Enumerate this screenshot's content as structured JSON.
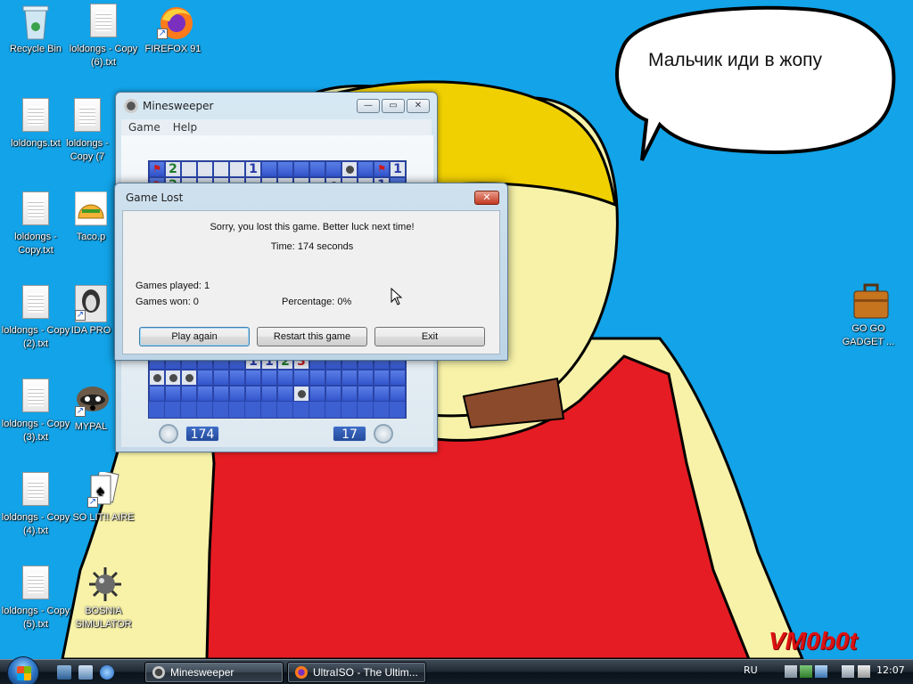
{
  "desktop": {
    "icons": [
      {
        "label": "Recycle Bin",
        "icon": "recycle-bin-icon"
      },
      {
        "label": "loldongs - Copy (6).txt",
        "icon": "text-file-icon"
      },
      {
        "label": "FIREFOX 91",
        "icon": "firefox-icon"
      },
      {
        "label": "loldongs.txt",
        "icon": "text-file-icon"
      },
      {
        "label": "loldongs - Copy (7",
        "icon": "text-file-icon"
      },
      {
        "label": "loldongs - Copy.txt",
        "icon": "text-file-icon"
      },
      {
        "label": "Taco.p",
        "icon": "taco-icon"
      },
      {
        "label": "loldongs - Copy (2).txt",
        "icon": "text-file-icon"
      },
      {
        "label": "IDA PRO",
        "icon": "ida-pro-icon"
      },
      {
        "label": "loldongs - Copy (3).txt",
        "icon": "text-file-icon"
      },
      {
        "label": "MYPAL",
        "icon": "raccoon-icon"
      },
      {
        "label": "loldongs - Copy (4).txt",
        "icon": "text-file-icon"
      },
      {
        "label": "SO LIT!! AIRE",
        "icon": "solitaire-icon"
      },
      {
        "label": "loldongs - Copy (5).txt",
        "icon": "text-file-icon"
      },
      {
        "label": "BOSNIA SIMULATOR",
        "icon": "mine-icon"
      },
      {
        "label": "GO GO GADGET ...",
        "icon": "briefcase-icon"
      }
    ],
    "speech_bubble": "Мальчик иди в жопу",
    "signature": "VM0b0t"
  },
  "minesweeper": {
    "title": "Minesweeper",
    "menu": [
      "Game",
      "Help"
    ],
    "time_counter": "174",
    "mine_counter": "17",
    "grid_rows": [
      "F2....1BBBBBMBF1",
      "F2.........M..1B",
      "BBBBBBBBBBBBBBBB",
      "BBBBBBBBBBBBBBBB",
      "BBBBBBBBBBBBBBBB",
      "BBBBBBBBBBBBBBBB",
      "BBBBBBBBBBBBBBBB",
      "BBBBBBBBBBBBBBBB",
      "BBBBBBBBBBBBBBBB",
      "BBBBBBBBBBBBBBBB",
      "BBBBBBBBBBBBBBBB",
      "BBBBM.2MM1113BMB",
      "BBBBBB1123BBBBBB",
      "MMMBBBBBBBBBBBBB",
      "BBBBBBBBBMBBBBBB"
    ]
  },
  "dialog": {
    "title": "Game Lost",
    "close_label": "✕",
    "message": "Sorry, you lost this game. Better luck next time!",
    "time": "Time: 174 seconds",
    "games_played": "Games played: 1",
    "games_won": "Games won: 0",
    "percentage": "Percentage: 0%",
    "buttons": {
      "play_again": "Play again",
      "restart": "Restart this game",
      "exit": "Exit"
    }
  },
  "taskbar": {
    "tasks": [
      {
        "label": "Minesweeper",
        "icon": "minesweeper-icon"
      },
      {
        "label": "UltraISO - The Ultim...",
        "icon": "firefox-icon"
      }
    ],
    "language": "RU",
    "clock": "12:07"
  }
}
